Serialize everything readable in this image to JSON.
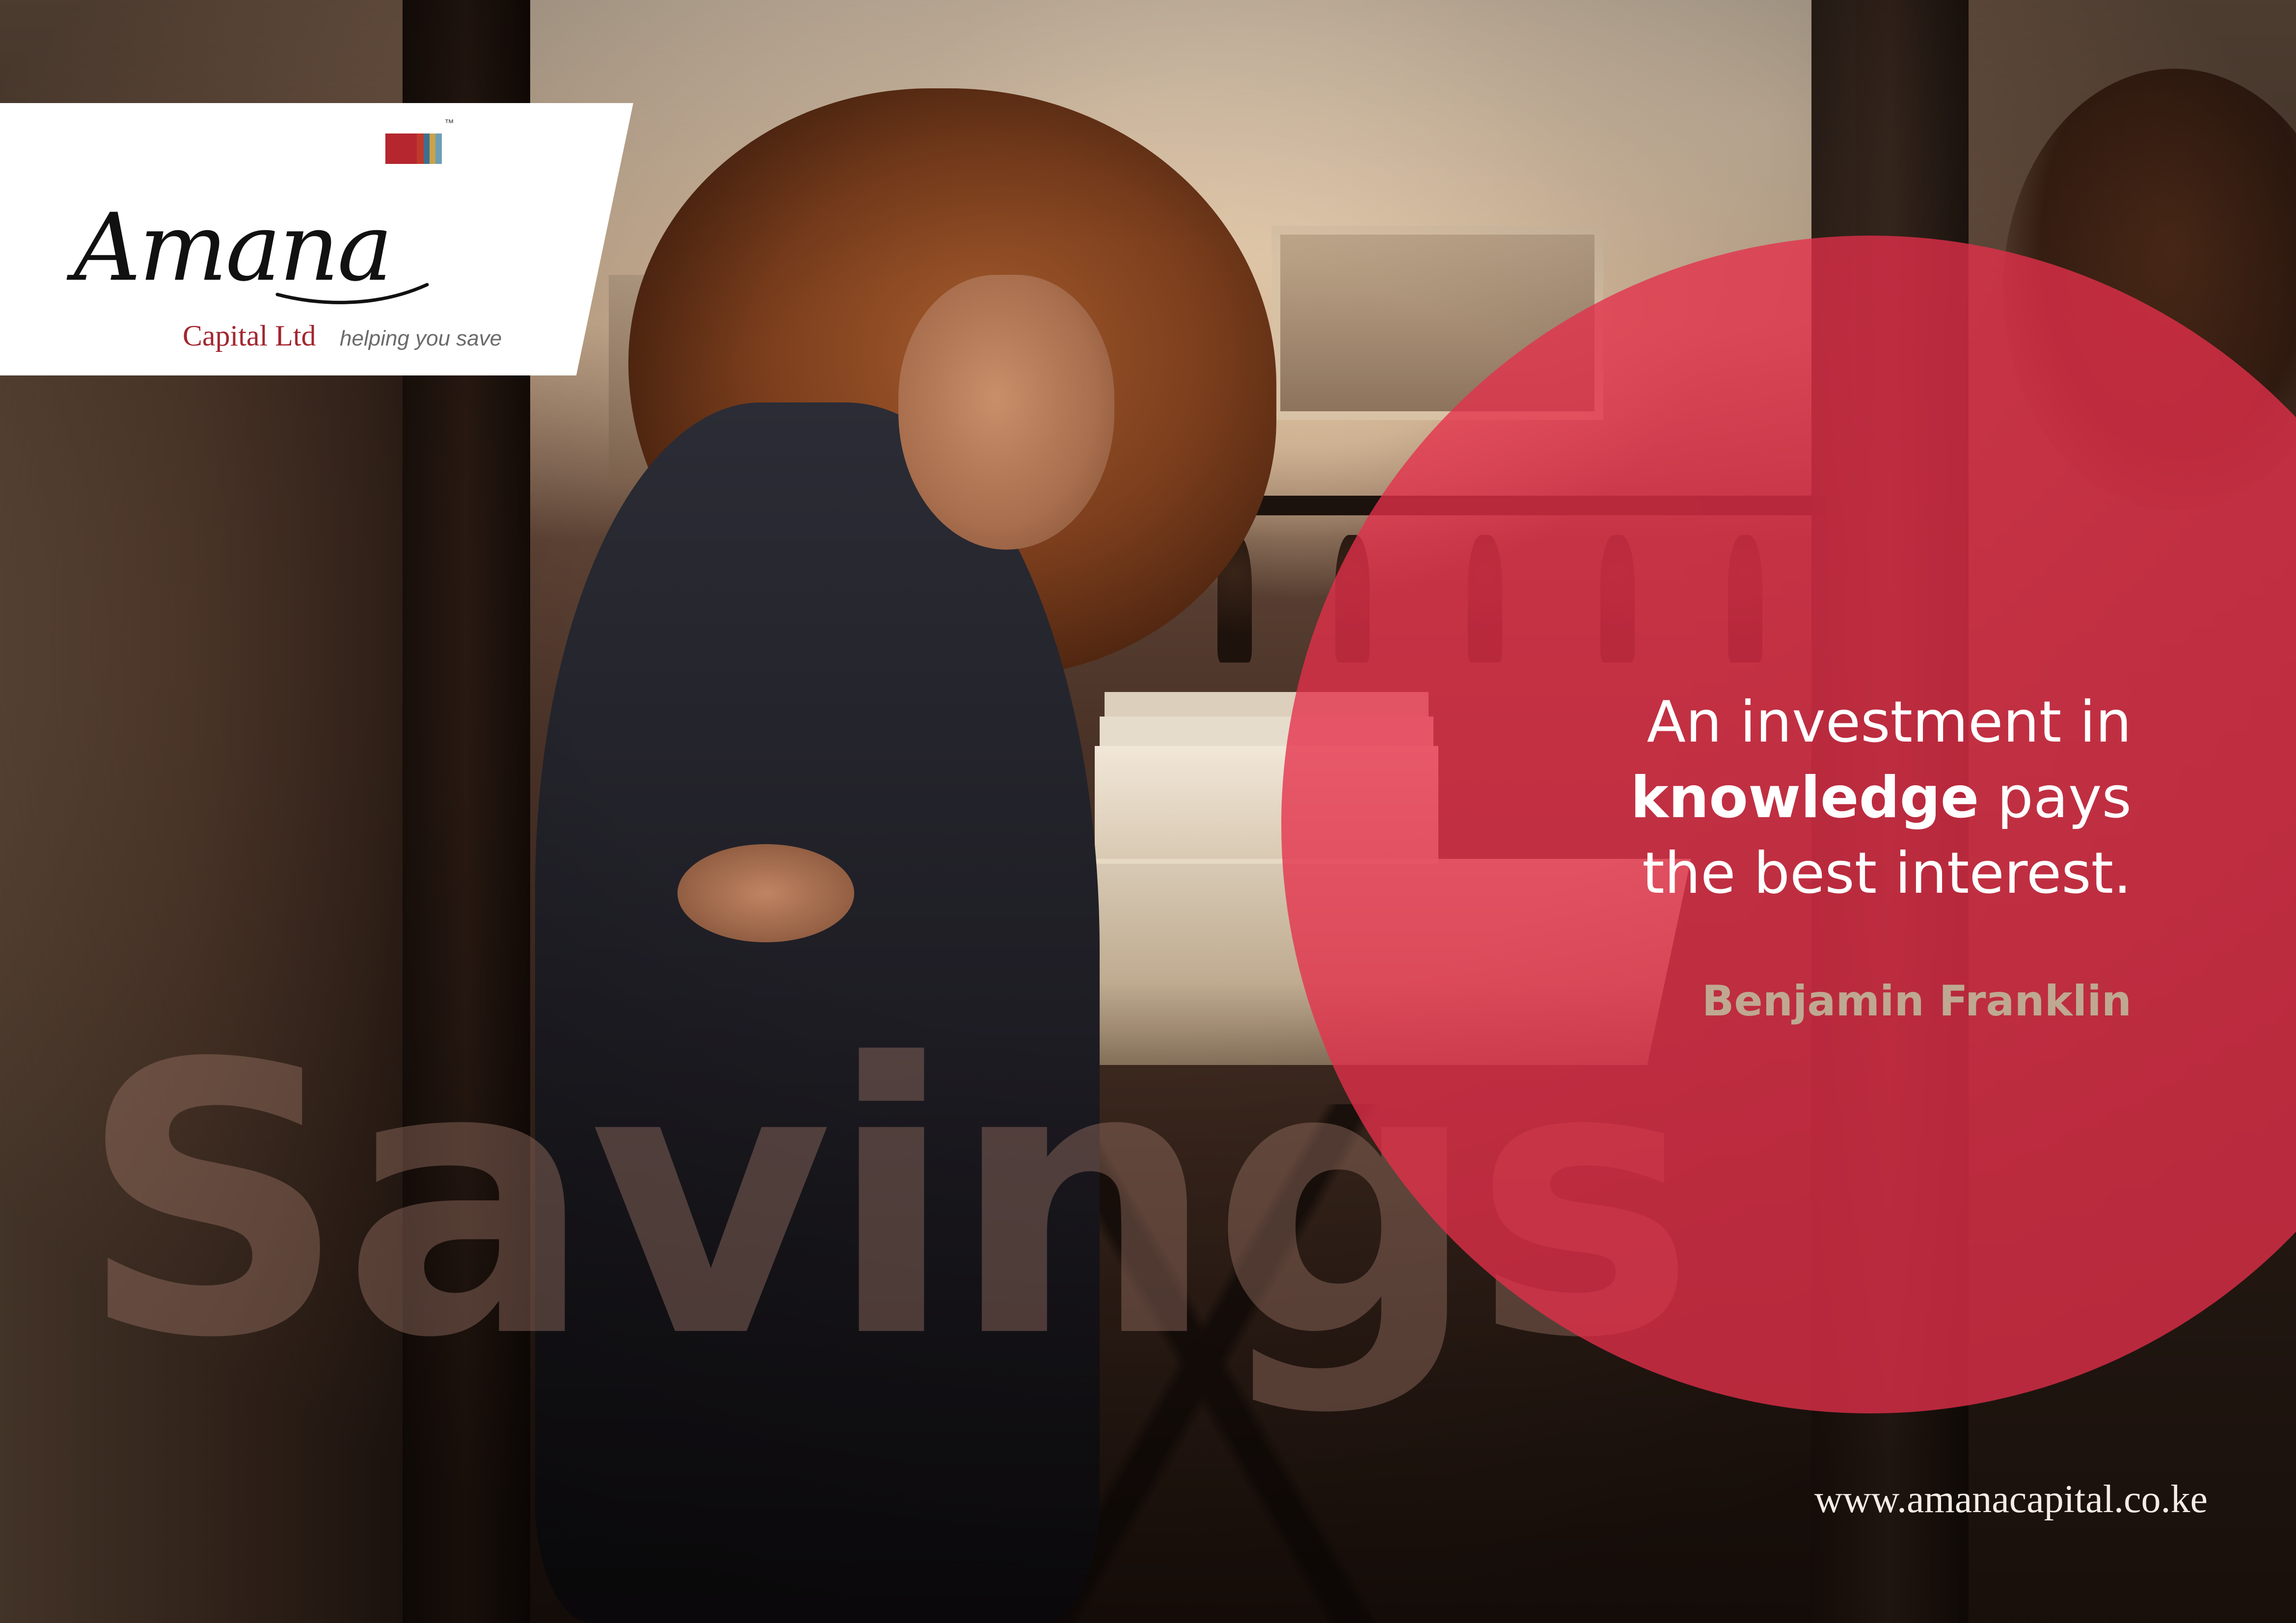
{
  "logo": {
    "script_name": "Amana",
    "subtitle": "Capital Ltd",
    "tagline": "helping you save",
    "trademark": "™",
    "bar_colors": [
      "#b5262f",
      "#c0392b",
      "#3f6f8f",
      "#c9a34a",
      "#6d9eb5"
    ]
  },
  "quote": {
    "line1": "An investment in",
    "line2_bold": "knowledge",
    "line2_rest": " pays",
    "line3": "the best interest.",
    "author": "Benjamin Franklin"
  },
  "watermark": "Savings",
  "website": "www.amanacapital.co.ke",
  "colors": {
    "accent_red": "#e4304a",
    "author_tan": "#bfa892",
    "brand_red": "#a3262f"
  }
}
